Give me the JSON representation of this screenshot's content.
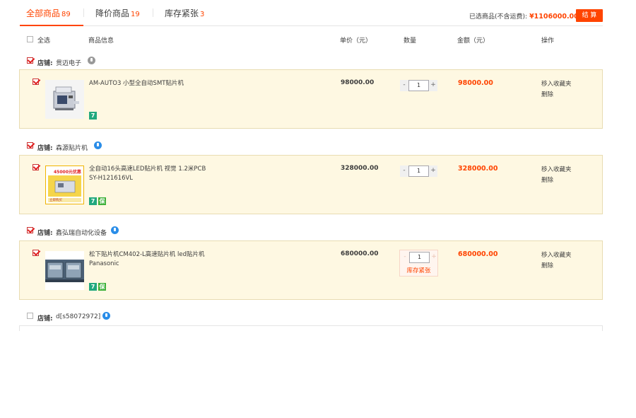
{
  "tabs": [
    {
      "label": "全部商品",
      "count": "89"
    },
    {
      "label": "降价商品",
      "count": "19"
    },
    {
      "label": "库存紧张",
      "count": "3"
    }
  ],
  "summary": {
    "label": "已选商品(不含运费):",
    "total": "¥1106000.00",
    "checkout": "结 算"
  },
  "header": {
    "select_all": "全选",
    "product_info": "商品信息",
    "unit_price": "单价（元）",
    "quantity": "数量",
    "amount": "金额（元）",
    "actions": "操作"
  },
  "shop_label": "店铺:",
  "shops": [
    {
      "name": "贯迈电子",
      "checked": true,
      "item": {
        "title": "AM-AUTO3 小型全自动SMT贴片机",
        "unit_price": "98000.00",
        "qty": "1",
        "amount": "98000.00",
        "badges": [
          "7"
        ],
        "stock_warning": ""
      }
    },
    {
      "name": "森源贴片机",
      "checked": true,
      "item": {
        "title": "全自动16头高速LED贴片机 视觉 1.2米PCB SY-H121616VL",
        "unit_price": "328000.00",
        "qty": "1",
        "amount": "328000.00",
        "badges": [
          "7",
          "保"
        ],
        "stock_warning": ""
      }
    },
    {
      "name": "鑫弘瑞自动化设备",
      "checked": true,
      "item": {
        "title": "松下贴片机CM402-L高速贴片机 led贴片机 Panasonic",
        "unit_price": "680000.00",
        "qty": "1",
        "amount": "680000.00",
        "badges": [
          "7",
          "保"
        ],
        "stock_warning": "库存紧张"
      }
    },
    {
      "name": "d[s58072972]",
      "checked": false
    }
  ],
  "item_actions": {
    "favorite": "移入收藏夹",
    "delete": "删除"
  },
  "qty_buttons": {
    "minus": "-",
    "plus": "+"
  },
  "thumb_promo": {
    "line1": "45000元优惠",
    "line2": "立即购买"
  },
  "colors": {
    "accent": "#ff4400",
    "item_bg": "#fef8e2",
    "info_icon_blue": "#2a8de8"
  }
}
